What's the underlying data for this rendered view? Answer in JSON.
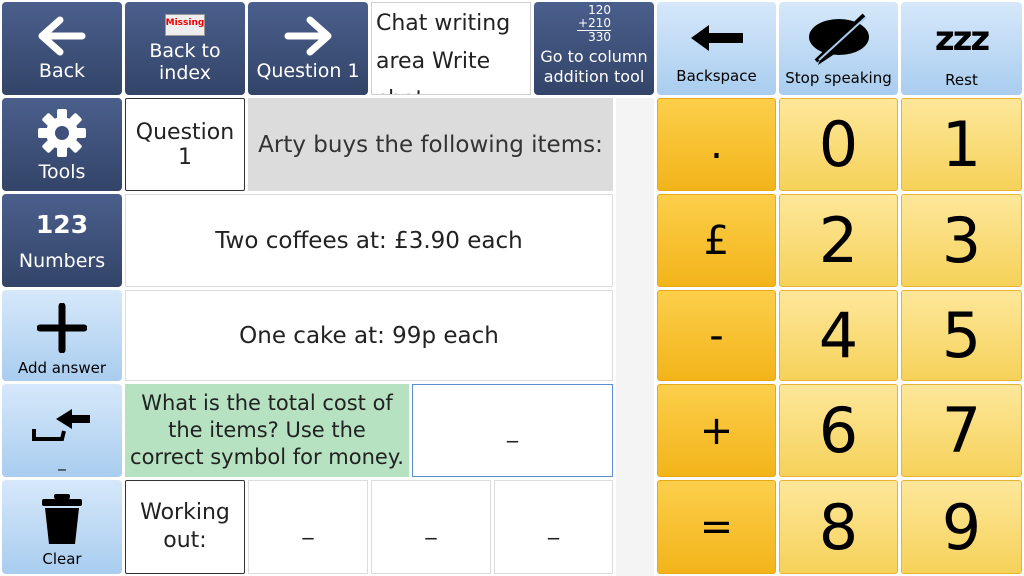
{
  "top_row": {
    "back_label": "Back",
    "back_to_index_line1": "Back to",
    "back_to_index_line2": "index",
    "missing_badge": "Missing",
    "question_label": "Question 1",
    "chat_area_text": "Chat writing area Write chat",
    "column_tool_line1": "Go to column",
    "column_tool_line2": "addition tool",
    "column_sum_a": "120",
    "column_sum_b": "+210",
    "column_sum_total": "330",
    "backspace_label": "Backspace",
    "stop_speaking_label": "Stop speaking",
    "rest_label": "Rest",
    "rest_glyph": "zzz"
  },
  "sidebar": {
    "tools_label": "Tools",
    "numbers_glyph": "123",
    "numbers_label": "Numbers",
    "add_answer_label": "Add answer",
    "enter_label": "_",
    "clear_label": "Clear"
  },
  "question": {
    "number_label": "Question 1",
    "intro": "Arty buys the following items:",
    "item1": "Two coffees at: £3.90 each",
    "item2": "One cake at: 99p each",
    "prompt": "What is the total cost of the items? Use the correct symbol for money.",
    "answer_value": "_",
    "working_out_label": "Working out:",
    "working_cells": [
      "_",
      "_",
      "_"
    ]
  },
  "keypad": {
    "symbols": [
      ".",
      "£",
      "-",
      "+",
      "="
    ],
    "digits": [
      "0",
      "1",
      "2",
      "3",
      "4",
      "5",
      "6",
      "7",
      "8",
      "9"
    ]
  },
  "colors": {
    "navy": "#3b4d75",
    "light_blue": "#b8d6f3",
    "grey_panel": "#dcdcdc",
    "green_prompt": "#b6e2c1",
    "key_yellow": "#f9dc6e",
    "key_orange": "#f7c232"
  }
}
